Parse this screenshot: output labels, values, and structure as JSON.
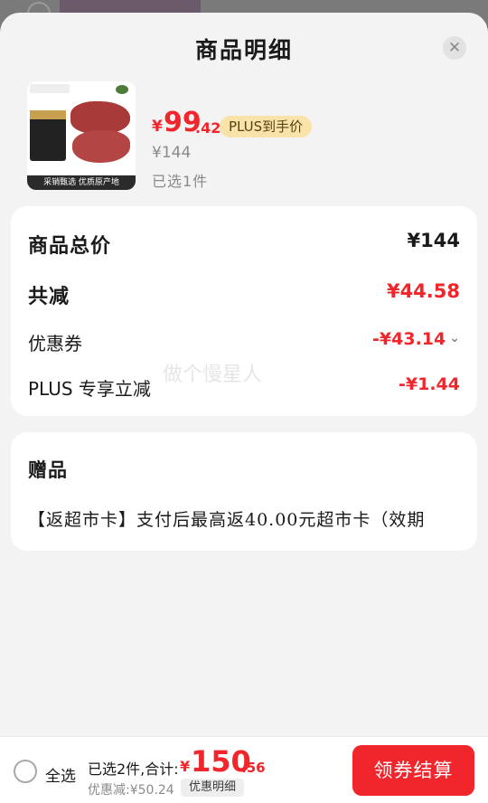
{
  "sheet": {
    "title": "商品明细",
    "close_icon": "close-icon"
  },
  "product": {
    "image_strip_text": "采销甄选  优质原产地",
    "price_currency": "¥",
    "price_int": "99",
    "price_dec": ".42",
    "plus_tag": "PLUS到手价",
    "original_price": "¥144",
    "selected_count": "已选1件"
  },
  "summary": {
    "total_label": "商品总价",
    "total_value": "¥144",
    "reduce_label": "共减",
    "reduce_value": "¥44.58",
    "coupon_label": "优惠券",
    "coupon_value": "-¥43.14",
    "plus_label": "PLUS 专享立减",
    "plus_value": "-¥1.44"
  },
  "watermark": "做个慢星人",
  "gift": {
    "title": "赠品",
    "text": "【返超市卡】支付后最高返40.00元超市卡（效期"
  },
  "bottom": {
    "select_all": "全选",
    "total_label": "已选2件,合计:",
    "total_currency": "¥",
    "total_int": "150",
    "total_dec": ".56",
    "discount_text": "优惠减:¥50.24",
    "discount_detail_btn": "优惠明细",
    "checkout_btn": "领券结算"
  },
  "colors": {
    "accent_red": "#f0262c",
    "plus_gold": "#f9e3a8"
  }
}
